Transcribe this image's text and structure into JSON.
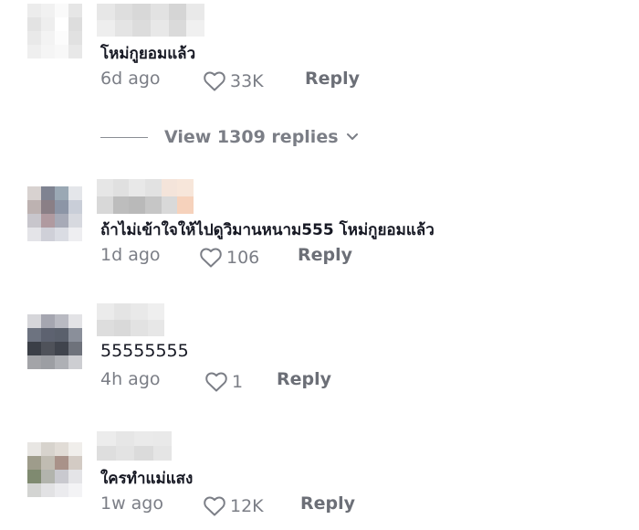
{
  "comments": [
    {
      "text": "โหม่กูยอมแล้ว",
      "time": "6d ago",
      "likes": "33K",
      "reply_label": "Reply",
      "view_replies_label": "View 1309 replies"
    },
    {
      "text": "ถ้าไม่เข้าใจให้ไปดูวิมานหนาม555 โหม่กูยอมแล้ว",
      "time": "1d ago",
      "likes": "106",
      "reply_label": "Reply"
    },
    {
      "text": "55555555",
      "time": "4h ago",
      "likes": "1",
      "reply_label": "Reply"
    },
    {
      "text": "ใครทำแม่แสง",
      "time": "1w ago",
      "likes": "12K",
      "reply_label": "Reply"
    }
  ],
  "colors": {
    "text": "#161823",
    "meta": "#7b7e86"
  },
  "icons": {
    "like": "heart-outline-icon",
    "expand": "chevron-down-icon"
  }
}
